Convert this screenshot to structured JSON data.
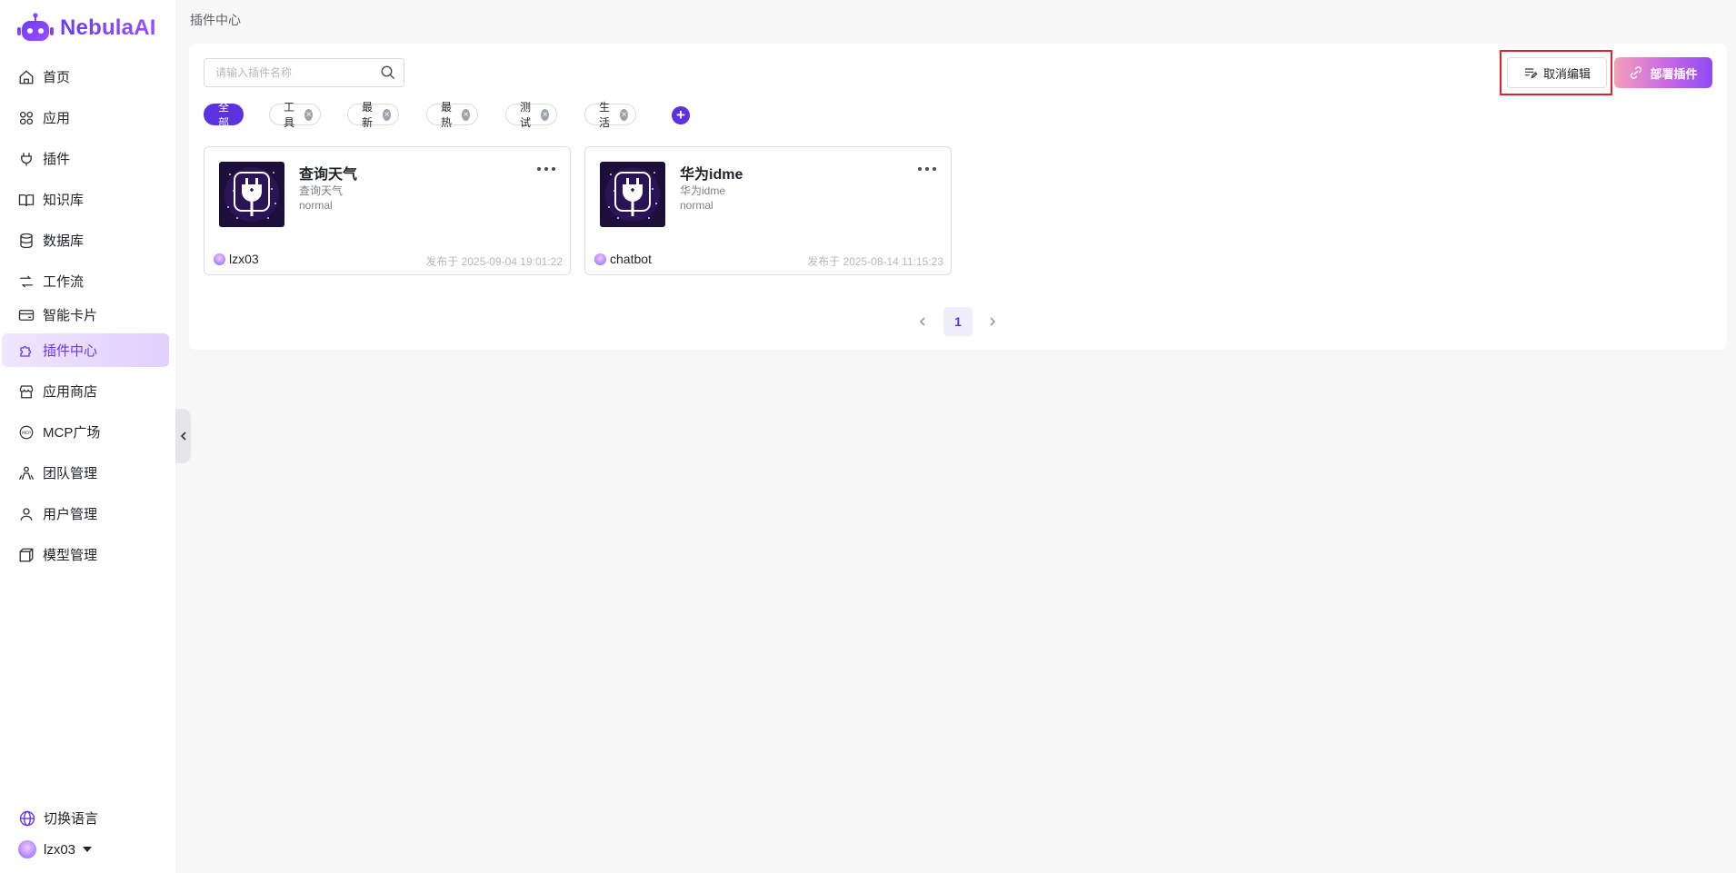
{
  "brand": {
    "name": "NebulaAI",
    "accent": "#6b36e8"
  },
  "sidebar": {
    "items": [
      {
        "label": "首页",
        "icon": "home-icon"
      },
      {
        "label": "应用",
        "icon": "apps-grid-icon"
      },
      {
        "label": "插件",
        "icon": "plug-icon"
      },
      {
        "label": "知识库",
        "icon": "book-icon"
      },
      {
        "label": "数据库",
        "icon": "database-icon"
      },
      {
        "label": "工作流",
        "icon": "workflow-icon"
      },
      {
        "label": "智能卡片",
        "icon": "card-icon"
      },
      {
        "label": "插件中心",
        "icon": "puzzle-icon",
        "active": true
      },
      {
        "label": "应用商店",
        "icon": "store-icon"
      },
      {
        "label": "MCP广场",
        "icon": "mcp-icon"
      },
      {
        "label": "团队管理",
        "icon": "team-icon"
      },
      {
        "label": "用户管理",
        "icon": "user-icon"
      },
      {
        "label": "模型管理",
        "icon": "cube-icon"
      }
    ],
    "language_label": "切换语言",
    "user_name": "lzx03"
  },
  "breadcrumb": "插件中心",
  "search": {
    "placeholder": "请输入插件名称",
    "value": ""
  },
  "actions": {
    "cancel_edit": "取消编辑",
    "deploy": "部署插件"
  },
  "tags": [
    {
      "label": "全部",
      "active": true
    },
    {
      "label": "工具"
    },
    {
      "label": "最新"
    },
    {
      "label": "最热"
    },
    {
      "label": "测试"
    },
    {
      "label": "生活"
    }
  ],
  "plugins": [
    {
      "title": "查询天气",
      "subtitle": "查询天气",
      "type": "normal",
      "author": "lzx03",
      "date": "发布于 2025-09-04 19:01:22"
    },
    {
      "title": "华为idme",
      "subtitle": "华为idme",
      "type": "normal",
      "author": "chatbot",
      "date": "发布于 2025-08-14 11:15:23"
    }
  ],
  "pagination": {
    "current": "1"
  }
}
